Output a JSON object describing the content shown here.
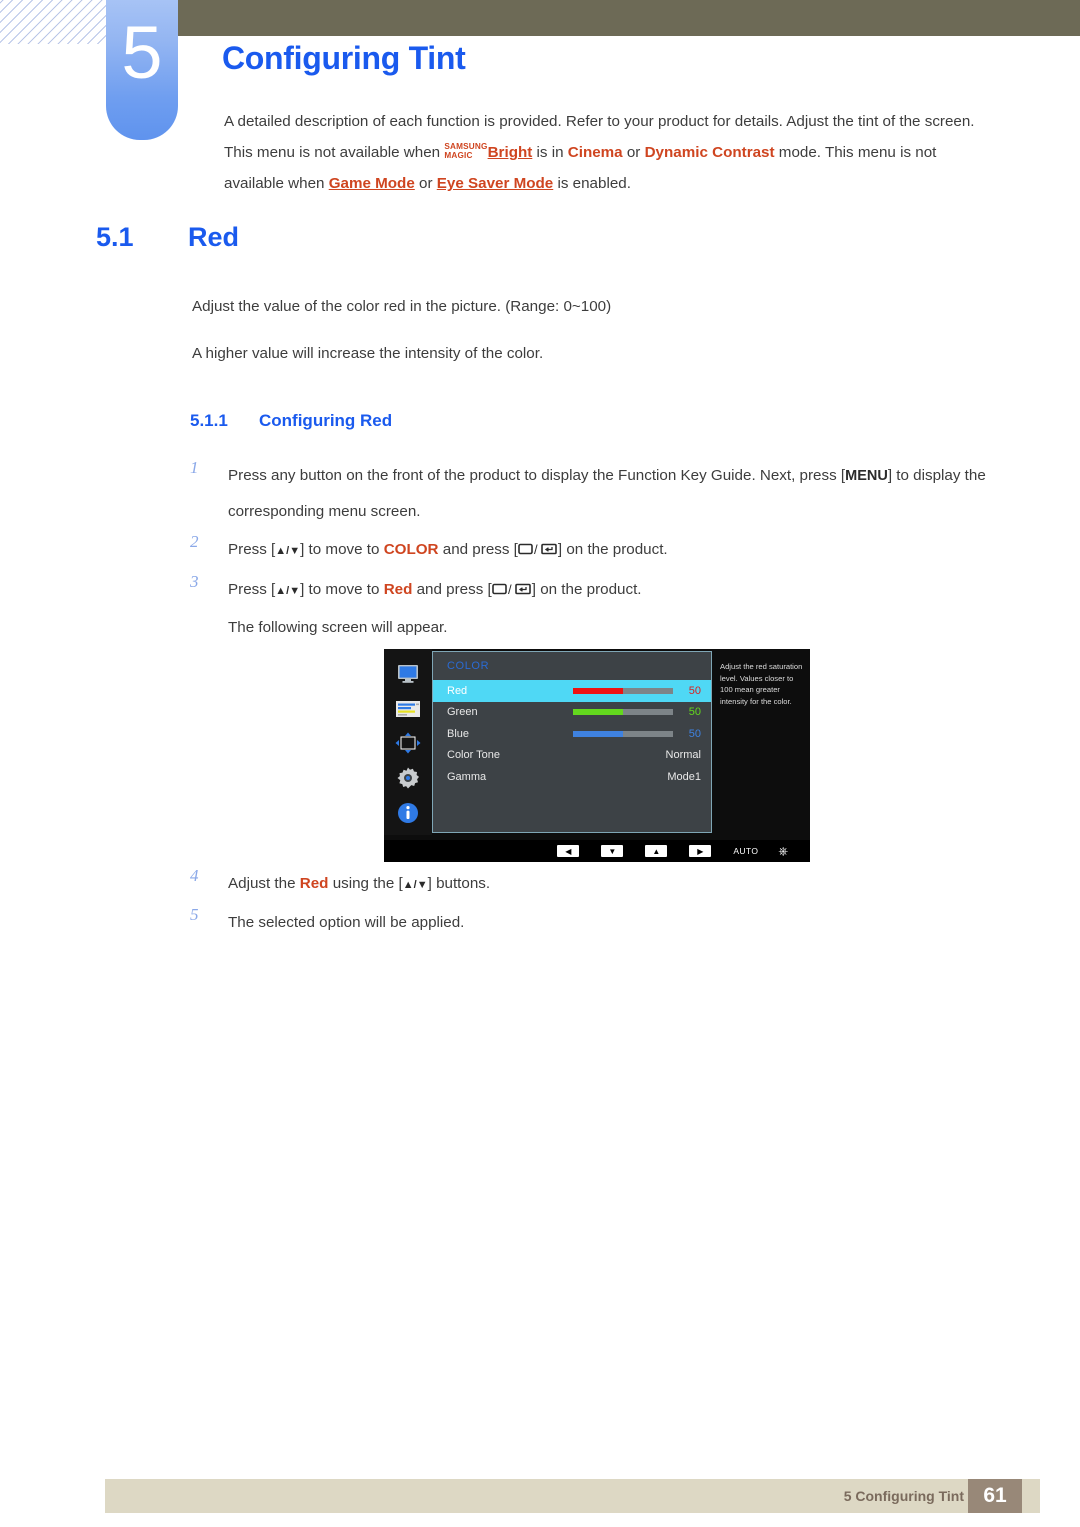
{
  "header": {
    "chapter_number": "5",
    "chapter_title": "Configuring Tint",
    "intro_part1": "A detailed description of each function is provided. Refer to your product for details. Adjust the tint of the screen. This menu is not available when ",
    "magic_line1": "SAMSUNG",
    "magic_line2": "MAGIC",
    "magic_bright": "Bright",
    "intro_part2": " is in ",
    "cinema": "Cinema",
    "intro_or1": " or ",
    "dynamic_contrast": "Dynamic Contrast",
    "intro_part3": " mode. This menu is not available when ",
    "game_mode": "Game Mode",
    "intro_or2": " or ",
    "eye_saver_mode": "Eye Saver Mode",
    "intro_part4": " is enabled."
  },
  "section": {
    "number": "5.1",
    "title": "Red",
    "paragraph1": "Adjust the value of the color red in the picture. (Range: 0~100)",
    "paragraph2": "A higher value will increase the intensity of the color.",
    "sub_number": "5.1.1",
    "sub_title": "Configuring Red"
  },
  "steps": [
    {
      "number": "1",
      "text_before": "Press any button on the front of the product to display the Function Key Guide. Next, press [",
      "key": "MENU",
      "text_after": "] to display the corresponding menu screen."
    },
    {
      "number": "2",
      "text_a": "Press [",
      "arrows": "▲/▼",
      "text_b": "] to move to ",
      "highlight": "COLOR",
      "text_c": " and press [",
      "text_d": "] on the product."
    },
    {
      "number": "3",
      "text_a": "Press [",
      "arrows": "▲/▼",
      "text_b": "] to move to ",
      "highlight": "Red",
      "text_c": " and press [",
      "text_d": "] on the product.",
      "sub_text": "The following screen will appear."
    },
    {
      "number": "4",
      "text_a": "Adjust the ",
      "highlight": "Red",
      "text_b": " using the [",
      "arrows": "▲/▼",
      "text_c": "] buttons."
    },
    {
      "number": "5",
      "text_a": "The selected option will be applied."
    }
  ],
  "osd": {
    "sidebar_icons": [
      "display-icon",
      "picture-icon",
      "size-position-icon",
      "setup-gear-icon",
      "information-icon"
    ],
    "menu_heading": "COLOR",
    "rows": [
      {
        "label": "Red",
        "value": "50",
        "value_color": "#d92020",
        "fill_color": "#ee1111",
        "fill_pct": 50,
        "selected": true,
        "has_slider": true
      },
      {
        "label": "Green",
        "value": "50",
        "value_color": "#63d81e",
        "fill_color": "#63d81e",
        "fill_pct": 50,
        "selected": false,
        "has_slider": true
      },
      {
        "label": "Blue",
        "value": "50",
        "value_color": "#3f82e0",
        "fill_color": "#3f82e0",
        "fill_pct": 50,
        "selected": false,
        "has_slider": true
      },
      {
        "label": "Color Tone",
        "value": "Normal",
        "value_color": "#e8e8e8",
        "fill_color": "",
        "fill_pct": 0,
        "selected": false,
        "has_slider": false
      },
      {
        "label": "Gamma",
        "value": "Mode1",
        "value_color": "#e8e8e8",
        "fill_color": "",
        "fill_pct": 0,
        "selected": false,
        "has_slider": false
      }
    ],
    "help_text": "Adjust the red saturation level. Values closer to 100 mean greater intensity for the color.",
    "bottom_keys": [
      "◀",
      "▼",
      "▲",
      "▶"
    ],
    "auto_label": "AUTO",
    "power_icon": "power-icon"
  },
  "footer": {
    "text": "5 Configuring Tint",
    "page": "61"
  },
  "colors": {
    "accent_blue": "#1a5aee",
    "accent_orange": "#cf4520",
    "olive": "#6d6a56",
    "footer_bg": "#ddd8c4",
    "page_box": "#988878",
    "osd_highlight": "#4fd8f5"
  }
}
